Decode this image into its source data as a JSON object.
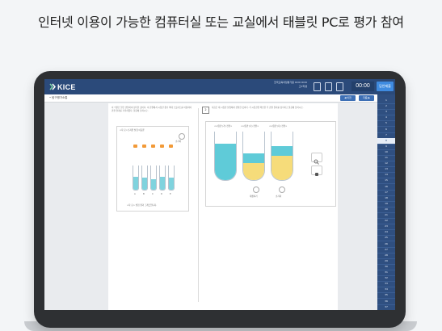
{
  "headline": "인터넷 이용이 가능한 컴퓨터실 또는 교실에서 태블릿 PC로 평가 참여",
  "app": {
    "logo_text": "KICE",
    "exam_info_line1": "한국교육과정평가원 OOO OOO",
    "exam_info_line2": "고3학생",
    "tools": [
      "pen-icon",
      "memo-icon",
      "zoom-icon"
    ],
    "timer": "00:00",
    "submit_label": "답안제출",
    "subbar_title": "• 탐구평가소통",
    "prev_label": "◀ 이전",
    "next_label": "다음 ▶"
  },
  "left_question": {
    "text": "이 식물은 알은 관찰하여 정리한 것이다. 이 관찰에서 시험관 종수 확대 스포이트를 이용하여 관찰 결과를 기록하였다. 물음에 답하시오.",
    "panel_title": "<자 료>오지뿐 실험 이동뿐",
    "caption": "<자 료> 실험 결과 그래프입니다.",
    "tube_labels": [
      "A",
      "B",
      "C",
      "D",
      "E"
    ],
    "tube_levels": [
      0.55,
      0.5,
      0.45,
      0.55,
      0.5
    ],
    "reset_label": "초기화"
  },
  "right_question": {
    "number": "2",
    "text": "다음은 세 시험관 실험에서 관찰한 것이다. 각 시험관을 확인한 후 관찰 결과를 정리하고 물음에 답하시오.",
    "tube_titles": [
      "<시험관 (가) 전환>",
      "<시험관 (나) 전환>",
      "<시험관 (다) 전환>"
    ],
    "tube_layers": [
      {
        "top": 0.25,
        "mid": 0.45,
        "bottom": 0.3
      },
      {
        "top": 0.45,
        "mid": 0.2,
        "bottom": 0.35
      },
      {
        "top": 0.3,
        "mid": 0.2,
        "bottom": 0.5
      }
    ],
    "play_label": "재생하기",
    "reset_label": "초기화"
  },
  "sidebar": {
    "items": [
      "1",
      "2",
      "3",
      "4",
      "5",
      "6",
      "7",
      "8",
      "9",
      "10",
      "11",
      "12",
      "13",
      "14",
      "15",
      "16",
      "17",
      "18",
      "19",
      "20",
      "21",
      "22",
      "23",
      "24",
      "25",
      "26",
      "27",
      "28",
      "29",
      "30",
      "31",
      "32",
      "33",
      "34",
      "35",
      "36",
      "37"
    ],
    "active_index": 7
  }
}
